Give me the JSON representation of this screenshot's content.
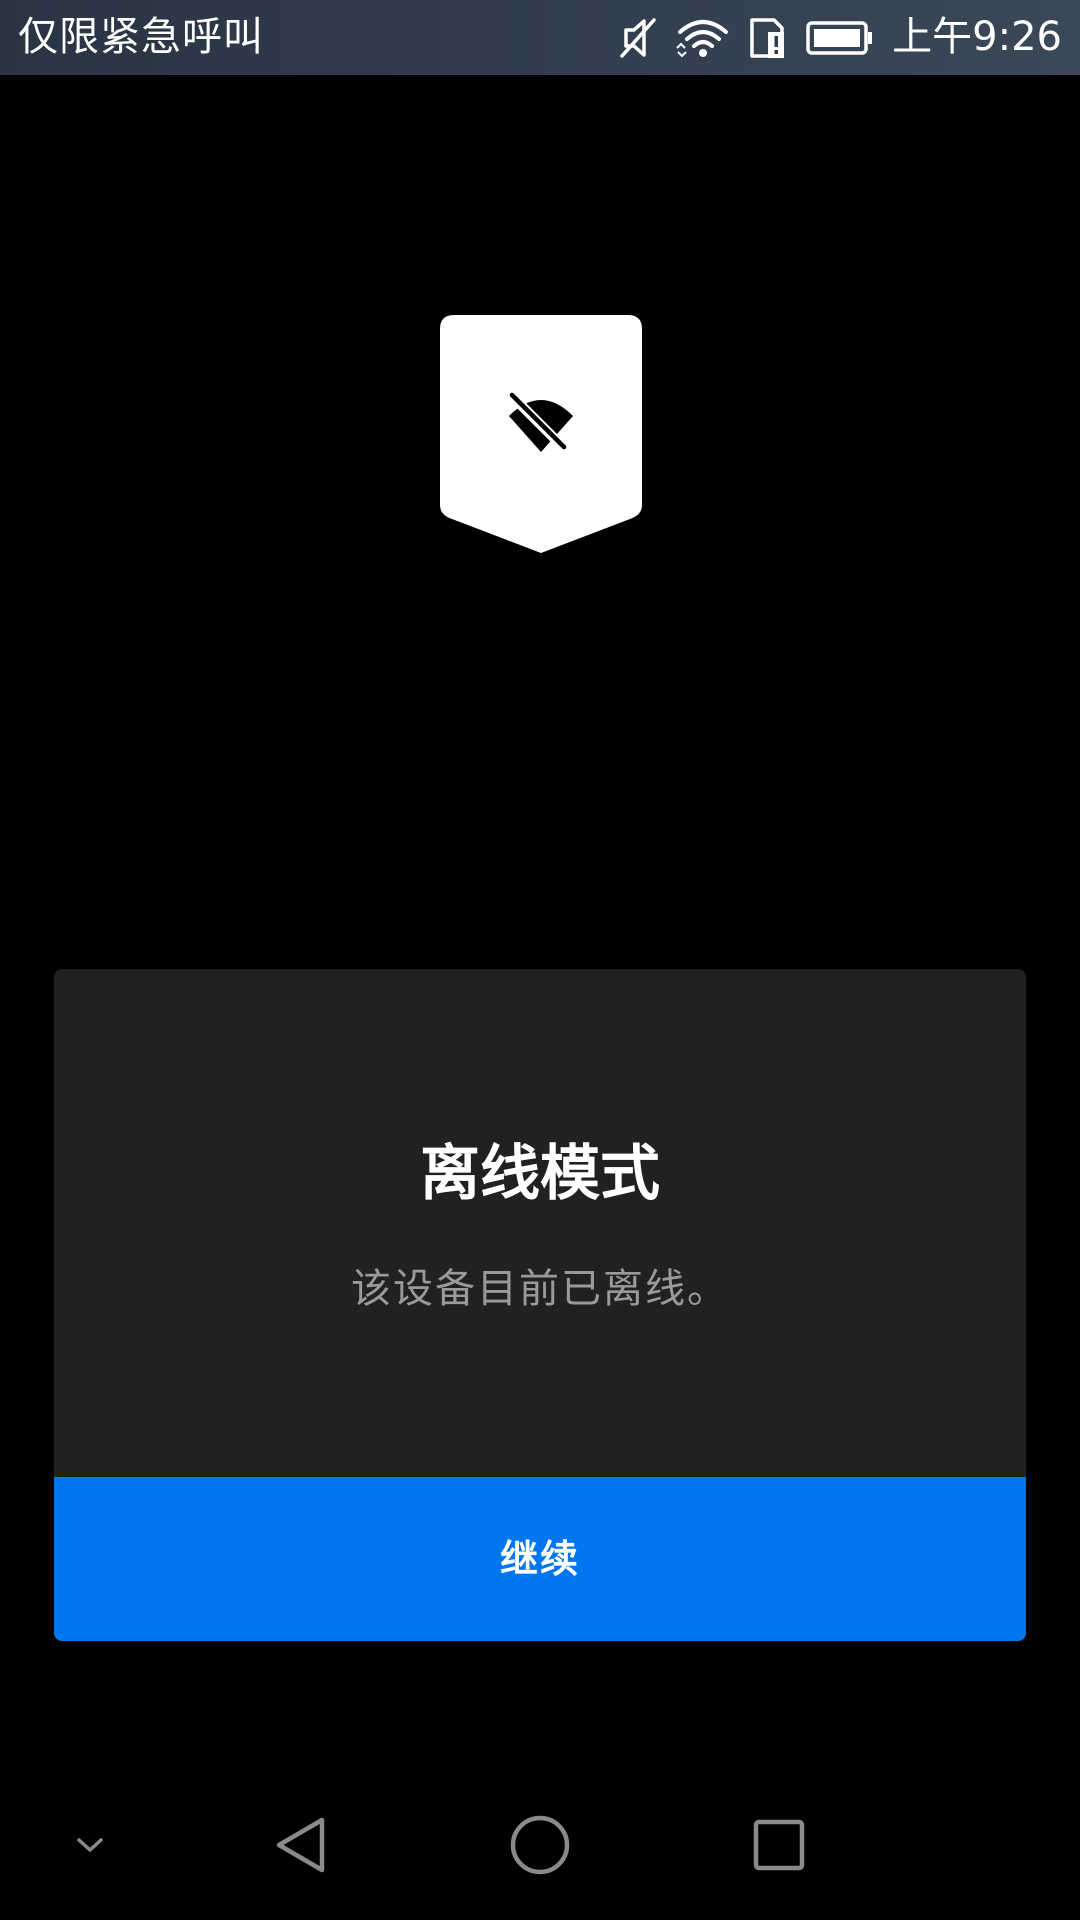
{
  "status_bar": {
    "carrier_text": "仅限紧急呼叫",
    "time": "上午9:26",
    "icons": [
      "mute-icon",
      "wifi-icon",
      "sim-alert-icon",
      "battery-icon"
    ]
  },
  "badge": {
    "icon": "wifi-off-icon"
  },
  "dialog": {
    "title": "离线模式",
    "message": "该设备目前已离线。",
    "continue_label": "继续"
  },
  "nav_bar": {
    "buttons": [
      "collapse-icon",
      "back-icon",
      "home-icon",
      "recents-icon"
    ]
  },
  "colors": {
    "status_bar_bg": "#2f3b4b",
    "screen_bg": "#000000",
    "dialog_bg": "#212121",
    "button_bg": "#0077ee",
    "message_text": "#9a9a9a"
  }
}
